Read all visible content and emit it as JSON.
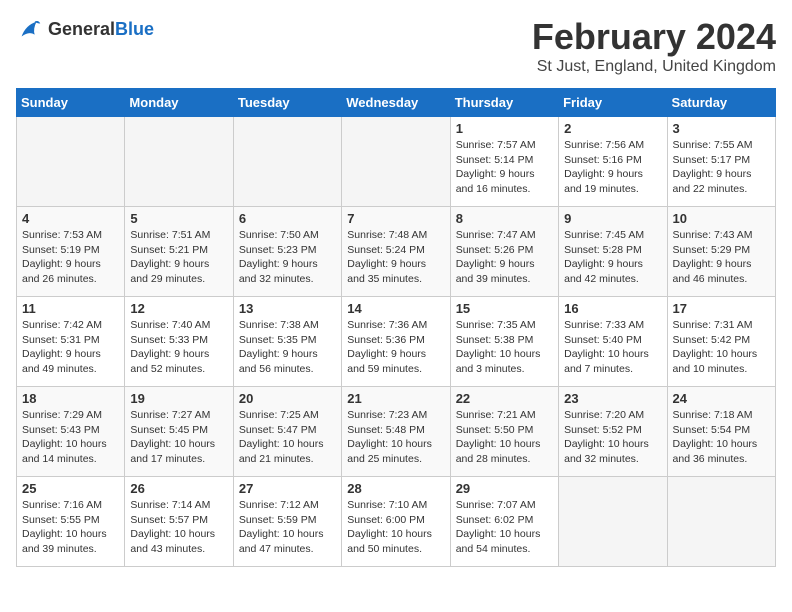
{
  "header": {
    "logo_general": "General",
    "logo_blue": "Blue",
    "month_title": "February 2024",
    "location": "St Just, England, United Kingdom"
  },
  "columns": [
    "Sunday",
    "Monday",
    "Tuesday",
    "Wednesday",
    "Thursday",
    "Friday",
    "Saturday"
  ],
  "weeks": [
    [
      {
        "day": "",
        "info": ""
      },
      {
        "day": "",
        "info": ""
      },
      {
        "day": "",
        "info": ""
      },
      {
        "day": "",
        "info": ""
      },
      {
        "day": "1",
        "info": "Sunrise: 7:57 AM\nSunset: 5:14 PM\nDaylight: 9 hours\nand 16 minutes."
      },
      {
        "day": "2",
        "info": "Sunrise: 7:56 AM\nSunset: 5:16 PM\nDaylight: 9 hours\nand 19 minutes."
      },
      {
        "day": "3",
        "info": "Sunrise: 7:55 AM\nSunset: 5:17 PM\nDaylight: 9 hours\nand 22 minutes."
      }
    ],
    [
      {
        "day": "4",
        "info": "Sunrise: 7:53 AM\nSunset: 5:19 PM\nDaylight: 9 hours\nand 26 minutes."
      },
      {
        "day": "5",
        "info": "Sunrise: 7:51 AM\nSunset: 5:21 PM\nDaylight: 9 hours\nand 29 minutes."
      },
      {
        "day": "6",
        "info": "Sunrise: 7:50 AM\nSunset: 5:23 PM\nDaylight: 9 hours\nand 32 minutes."
      },
      {
        "day": "7",
        "info": "Sunrise: 7:48 AM\nSunset: 5:24 PM\nDaylight: 9 hours\nand 35 minutes."
      },
      {
        "day": "8",
        "info": "Sunrise: 7:47 AM\nSunset: 5:26 PM\nDaylight: 9 hours\nand 39 minutes."
      },
      {
        "day": "9",
        "info": "Sunrise: 7:45 AM\nSunset: 5:28 PM\nDaylight: 9 hours\nand 42 minutes."
      },
      {
        "day": "10",
        "info": "Sunrise: 7:43 AM\nSunset: 5:29 PM\nDaylight: 9 hours\nand 46 minutes."
      }
    ],
    [
      {
        "day": "11",
        "info": "Sunrise: 7:42 AM\nSunset: 5:31 PM\nDaylight: 9 hours\nand 49 minutes."
      },
      {
        "day": "12",
        "info": "Sunrise: 7:40 AM\nSunset: 5:33 PM\nDaylight: 9 hours\nand 52 minutes."
      },
      {
        "day": "13",
        "info": "Sunrise: 7:38 AM\nSunset: 5:35 PM\nDaylight: 9 hours\nand 56 minutes."
      },
      {
        "day": "14",
        "info": "Sunrise: 7:36 AM\nSunset: 5:36 PM\nDaylight: 9 hours\nand 59 minutes."
      },
      {
        "day": "15",
        "info": "Sunrise: 7:35 AM\nSunset: 5:38 PM\nDaylight: 10 hours\nand 3 minutes."
      },
      {
        "day": "16",
        "info": "Sunrise: 7:33 AM\nSunset: 5:40 PM\nDaylight: 10 hours\nand 7 minutes."
      },
      {
        "day": "17",
        "info": "Sunrise: 7:31 AM\nSunset: 5:42 PM\nDaylight: 10 hours\nand 10 minutes."
      }
    ],
    [
      {
        "day": "18",
        "info": "Sunrise: 7:29 AM\nSunset: 5:43 PM\nDaylight: 10 hours\nand 14 minutes."
      },
      {
        "day": "19",
        "info": "Sunrise: 7:27 AM\nSunset: 5:45 PM\nDaylight: 10 hours\nand 17 minutes."
      },
      {
        "day": "20",
        "info": "Sunrise: 7:25 AM\nSunset: 5:47 PM\nDaylight: 10 hours\nand 21 minutes."
      },
      {
        "day": "21",
        "info": "Sunrise: 7:23 AM\nSunset: 5:48 PM\nDaylight: 10 hours\nand 25 minutes."
      },
      {
        "day": "22",
        "info": "Sunrise: 7:21 AM\nSunset: 5:50 PM\nDaylight: 10 hours\nand 28 minutes."
      },
      {
        "day": "23",
        "info": "Sunrise: 7:20 AM\nSunset: 5:52 PM\nDaylight: 10 hours\nand 32 minutes."
      },
      {
        "day": "24",
        "info": "Sunrise: 7:18 AM\nSunset: 5:54 PM\nDaylight: 10 hours\nand 36 minutes."
      }
    ],
    [
      {
        "day": "25",
        "info": "Sunrise: 7:16 AM\nSunset: 5:55 PM\nDaylight: 10 hours\nand 39 minutes."
      },
      {
        "day": "26",
        "info": "Sunrise: 7:14 AM\nSunset: 5:57 PM\nDaylight: 10 hours\nand 43 minutes."
      },
      {
        "day": "27",
        "info": "Sunrise: 7:12 AM\nSunset: 5:59 PM\nDaylight: 10 hours\nand 47 minutes."
      },
      {
        "day": "28",
        "info": "Sunrise: 7:10 AM\nSunset: 6:00 PM\nDaylight: 10 hours\nand 50 minutes."
      },
      {
        "day": "29",
        "info": "Sunrise: 7:07 AM\nSunset: 6:02 PM\nDaylight: 10 hours\nand 54 minutes."
      },
      {
        "day": "",
        "info": ""
      },
      {
        "day": "",
        "info": ""
      }
    ]
  ]
}
